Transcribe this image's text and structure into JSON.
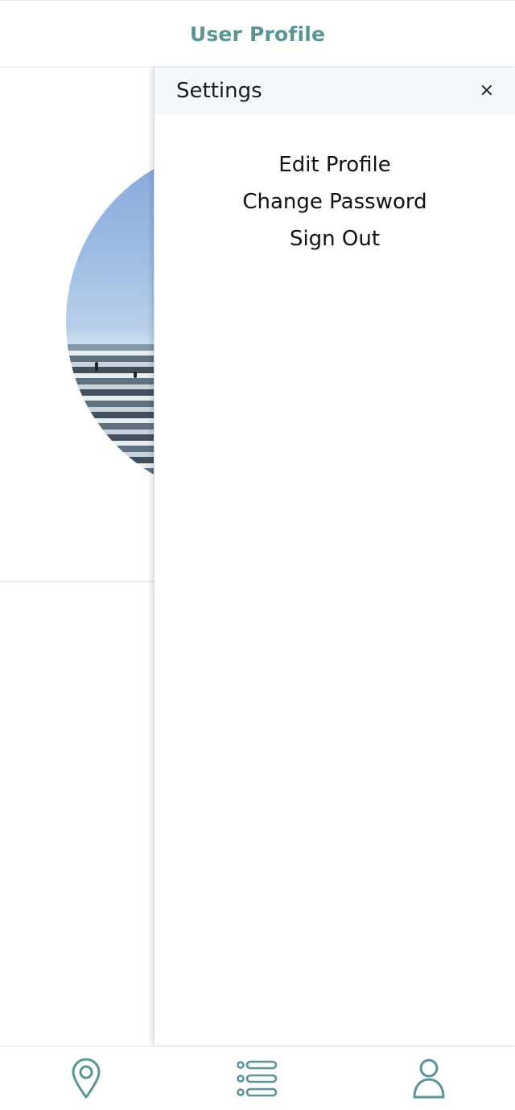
{
  "header": {
    "title": "User Profile"
  },
  "drawer": {
    "title": "Settings",
    "close_label": "×",
    "items": [
      {
        "label": "Edit Profile"
      },
      {
        "label": "Change Password"
      },
      {
        "label": "Sign Out"
      }
    ]
  },
  "bottom_nav": {
    "items": [
      {
        "icon": "location-pin-icon"
      },
      {
        "icon": "list-icon"
      },
      {
        "icon": "user-icon"
      }
    ]
  },
  "colors": {
    "accent": "#5b9494",
    "drawer_header_bg": "#f4f9fb"
  }
}
